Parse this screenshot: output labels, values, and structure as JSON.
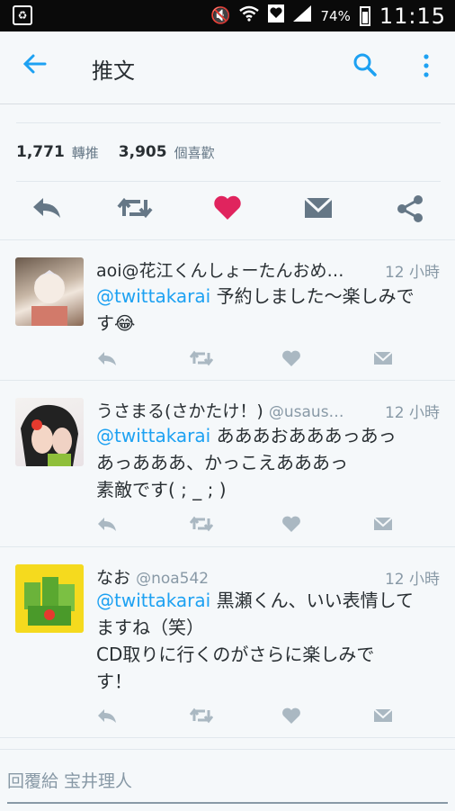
{
  "status_bar": {
    "battery": "74%",
    "time": "11:15"
  },
  "appbar": {
    "title": "推文"
  },
  "stats": {
    "retweets": "1,771",
    "retweets_label": "轉推",
    "likes": "3,905",
    "likes_label": "個喜歡"
  },
  "colors": {
    "accent": "#1da1f2",
    "like": "#e0245e",
    "text": "#292f33",
    "muted": "#8899a6"
  },
  "replies": [
    {
      "name": "aoi@花江くんしょーたんおめ…",
      "handle": "",
      "time": "12 小時",
      "mention": "@twittakarai",
      "line1": " 予約しました〜楽しみで",
      "line2": "す😂",
      "line3": ""
    },
    {
      "name": "うさまる(さかたけ！)",
      "handle": "@usaus…",
      "time": "12 小時",
      "mention": "@twittakarai",
      "line1": " あああおあああっあっ",
      "line2": "あっあああ、かっこえあああっ",
      "line3": "素敵です( ; _ ; )"
    },
    {
      "name": "なお",
      "handle": "@noa542",
      "time": "12 小時",
      "mention": "@twittakarai",
      "line1": " 黒瀬くん、いい表情して",
      "line2": "ますね（笑）",
      "line3": "CD取りに行くのがさらに楽しみで",
      "line4": "す！"
    }
  ],
  "composer": {
    "placeholder": "回覆給 宝井理人"
  }
}
